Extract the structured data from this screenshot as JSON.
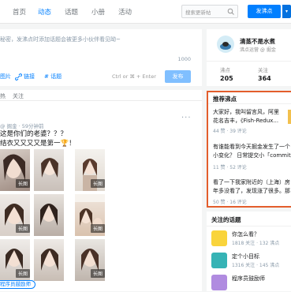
{
  "nav": {
    "items": [
      "首页",
      "动态",
      "话题",
      "小册",
      "活动"
    ],
    "active": "动态",
    "search_placeholder": "搜索更新帖",
    "post_button": "发沸点",
    "post_caret": "▾"
  },
  "composer": {
    "placeholder": "秘密，发沸点时添加话题会被更多小伙伴看见呦~",
    "char_count": "1000",
    "tools": [
      "图片",
      "链接",
      "# 话题"
    ],
    "shortcut_hint": "Ctrl or ⌘ + Enter",
    "publish_label": "发布"
  },
  "feed": {
    "tabs": [
      "热",
      "关注"
    ],
    "meta": "@ 掘金 · 59分钟前",
    "more": "···",
    "content_line1": "这是你们的老婆？？？",
    "content_line2": "结衣又又又又是第一🏆！",
    "thumb_tag": "长图",
    "topic_pill": "程序员鼓励师"
  },
  "profile": {
    "name": "清蒸不是水煮",
    "subtitle": "沸点运营 @ 掘金",
    "stats": [
      {
        "label": "沸点",
        "value": "205"
      },
      {
        "label": "关注",
        "value": "364"
      }
    ]
  },
  "recommended": {
    "title": "推荐沸点",
    "items": [
      {
        "line1": "大家好，我叫留言风，阿里",
        "line2": "花名吉丰，《Fish-Redux...",
        "meta": "44 赞 · 39 评论"
      },
      {
        "line1": "有谁能看到今天掘金发生了一个",
        "line2": "小变化？ 日常提交小「commit」",
        "meta": "11 赞 · 52 评论"
      },
      {
        "line1": "看了一下我家附近的（上海）房",
        "line2": "年多没看了，发现涨了很多。那",
        "meta": "50 赞 · 16 评论"
      }
    ]
  },
  "topics": {
    "title": "关注的话题",
    "items": [
      {
        "name": "你怎么看？",
        "meta": "1818 关注 · 132 沸点",
        "color": "#f9d43c"
      },
      {
        "name": "定个小目标",
        "meta": "1316 关注 · 145 沸点",
        "color": "#36b3b5"
      },
      {
        "name": "程序员鼓励师",
        "meta": "",
        "color": "#b08be0"
      }
    ]
  }
}
